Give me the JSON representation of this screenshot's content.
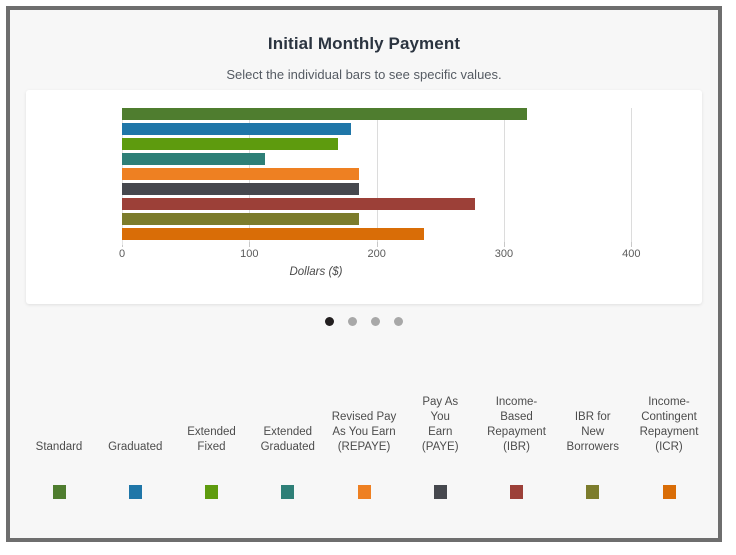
{
  "header": {
    "title": "Initial Monthly Payment",
    "subtitle": "Select the individual bars to see specific values."
  },
  "chart_data": {
    "type": "bar",
    "orientation": "horizontal",
    "title": "Initial Monthly Payment",
    "subtitle": "Select the individual bars to see specific values.",
    "xlabel": "Dollars ($)",
    "ylabel": "",
    "xlim": [
      0,
      420
    ],
    "xticks": [
      0,
      100,
      200,
      300,
      400
    ],
    "xtick_labels": [
      "0",
      "100",
      "200",
      "300",
      "400"
    ],
    "grid": "vertical",
    "legend_position": "bottom",
    "categories": [
      "Standard",
      "Graduated",
      "Extended\nFixed",
      "Extended\nGraduated",
      "Revised Pay\nAs You Earn\n(REPAYE)",
      "Pay As\nYou\nEarn\n(PAYE)",
      "Income-\nBased\nRepayment\n(IBR)",
      "IBR for\nNew\nBorrowers",
      "Income-\nContingent\nRepayment\n(ICR)"
    ],
    "values": [
      318,
      180,
      170,
      112,
      186,
      186,
      277,
      186,
      237
    ],
    "colors": [
      "#4f7d2f",
      "#1f76a8",
      "#5e9b0e",
      "#2e7f77",
      "#ee8022",
      "#46484e",
      "#9c4038",
      "#7c7c2c",
      "#d96d07"
    ]
  },
  "pagination": {
    "dots": [
      {
        "active": true
      },
      {
        "active": false
      },
      {
        "active": false
      },
      {
        "active": false
      }
    ]
  }
}
